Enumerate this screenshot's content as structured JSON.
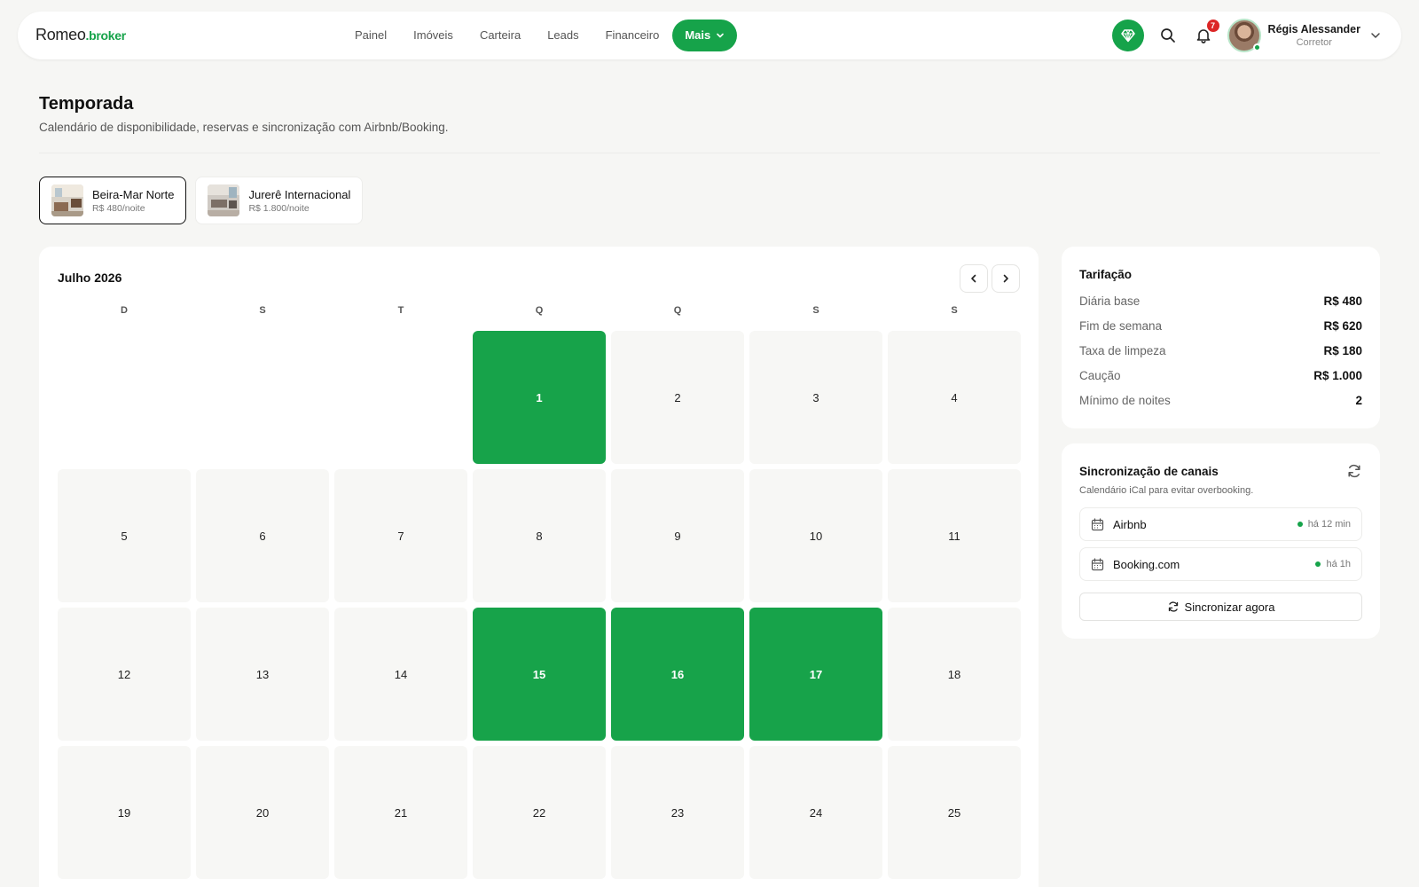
{
  "brand": {
    "name": "Romeo",
    "suffix": ".broker",
    "accent": "#16a34a"
  },
  "nav": {
    "items": [
      {
        "label": "Painel"
      },
      {
        "label": "Imóveis"
      },
      {
        "label": "Carteira"
      },
      {
        "label": "Leads"
      },
      {
        "label": "Financeiro"
      }
    ],
    "more_label": "Mais"
  },
  "header_tools": {
    "premium_icon": "diamond-icon",
    "search_icon": "search-icon",
    "notifications_icon": "bell-icon",
    "notification_count": "7"
  },
  "user": {
    "name": "Régis Alessander",
    "role": "Corretor",
    "status": "online"
  },
  "page": {
    "title": "Temporada",
    "subtitle": "Calendário de disponibilidade, reservas e sincronização com Airbnb/Booking."
  },
  "properties": [
    {
      "name": "Beira-Mar Norte",
      "price": "R$ 480/noite",
      "selected": true
    },
    {
      "name": "Jurerê Internacional",
      "price": "R$ 1.800/noite",
      "selected": false
    }
  ],
  "calendar": {
    "month_label": "Julho 2026",
    "weekdays": [
      "D",
      "S",
      "T",
      "Q",
      "Q",
      "S",
      "S"
    ],
    "leading_blanks": 3,
    "days": [
      "1",
      "2",
      "3",
      "4",
      "5",
      "6",
      "7",
      "8",
      "9",
      "10",
      "11",
      "12",
      "13",
      "14",
      "15",
      "16",
      "17",
      "18",
      "19",
      "20",
      "21",
      "22",
      "23",
      "24",
      "25"
    ],
    "booked_days": [
      "1",
      "15",
      "16",
      "17"
    ],
    "booked_color": "#17a34a"
  },
  "rates": {
    "title": "Tarifação",
    "rows": [
      {
        "label": "Diária base",
        "value": "R$ 480"
      },
      {
        "label": "Fim de semana",
        "value": "R$ 620"
      },
      {
        "label": "Taxa de limpeza",
        "value": "R$ 180"
      },
      {
        "label": "Caução",
        "value": "R$ 1.000"
      },
      {
        "label": "Mínimo de noites",
        "value": "2"
      }
    ]
  },
  "sync": {
    "title": "Sincronização de canais",
    "subtitle": "Calendário iCal para evitar overbooking.",
    "channels": [
      {
        "name": "Airbnb",
        "last_sync": "há 12 min",
        "status": "ok"
      },
      {
        "name": "Booking.com",
        "last_sync": "há 1h",
        "status": "ok"
      }
    ],
    "button_label": "Sincronizar agora"
  }
}
